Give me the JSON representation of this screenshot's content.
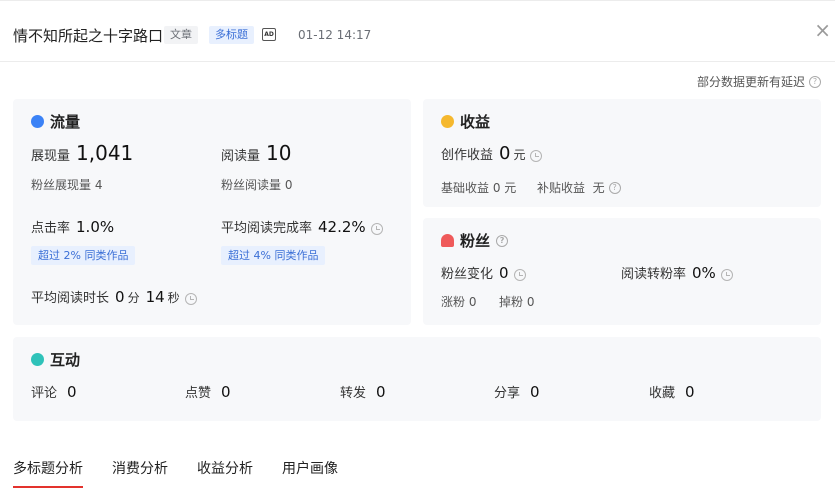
{
  "header": {
    "title": "情不知所起之十字路口",
    "tag_article": "文章",
    "tag_multi": "多标题",
    "ad_icon": "AD",
    "date": "01-12 14:17",
    "close_icon": "×"
  },
  "notice": "部分数据更新有延迟",
  "traffic": {
    "title": "流量",
    "impressions_label": "展现量",
    "impressions_value": "1,041",
    "reads_label": "阅读量",
    "reads_value": "10",
    "fan_impressions": "粉丝展现量 4",
    "fan_reads": "粉丝阅读量 0",
    "ctr_label": "点击率",
    "ctr_value": "1.0%",
    "ctr_badge": "超过 2% 同类作品",
    "completion_label": "平均阅读完成率",
    "completion_value": "42.2%",
    "completion_badge": "超过 4% 同类作品",
    "duration_label": "平均阅读时长",
    "duration_min": "0",
    "duration_min_unit": "分",
    "duration_sec": "14",
    "duration_sec_unit": "秒"
  },
  "income": {
    "title": "收益",
    "creation_label": "创作收益",
    "creation_value": "0",
    "creation_unit": "元",
    "base": "基础收益 0 元",
    "subsidy": "补贴收益  无"
  },
  "fans": {
    "title": "粉丝",
    "change_label": "粉丝变化",
    "change_value": "0",
    "conversion_label": "阅读转粉率",
    "conversion_value": "0%",
    "gain": "涨粉 0",
    "loss": "掉粉 0"
  },
  "interaction": {
    "title": "互动",
    "items": [
      {
        "label": "评论",
        "value": "0"
      },
      {
        "label": "点赞",
        "value": "0"
      },
      {
        "label": "转发",
        "value": "0"
      },
      {
        "label": "分享",
        "value": "0"
      },
      {
        "label": "收藏",
        "value": "0"
      }
    ]
  },
  "tabs": [
    {
      "label": "多标题分析",
      "active": true
    },
    {
      "label": "消费分析"
    },
    {
      "label": "收益分析"
    },
    {
      "label": "用户画像"
    }
  ],
  "colors": {
    "traffic_icon": "#3b82f6",
    "income_icon": "#f5b82e",
    "fans_icon": "#ef5a5a",
    "interaction_icon": "#2fc2b9",
    "active_tab": "#e3322d"
  }
}
